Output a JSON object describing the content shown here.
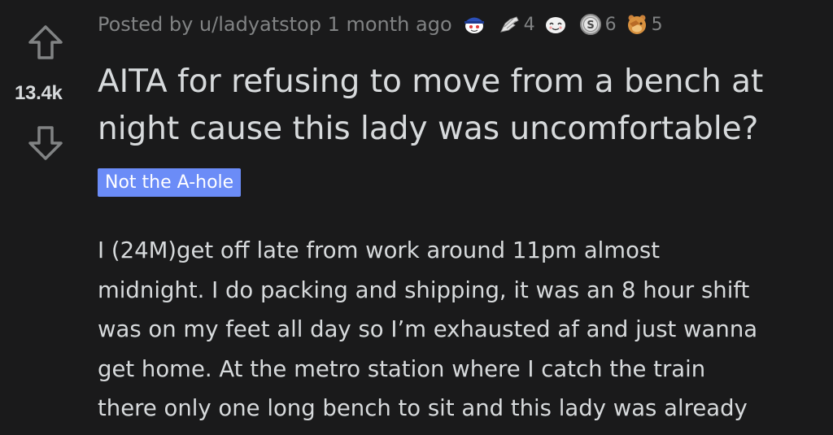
{
  "post": {
    "vote_count": "13.4k",
    "posted_by": "Posted by u/ladyatstop 1 month ago",
    "awards": [
      {
        "icon": "snoo-cap-award-icon",
        "count": ""
      },
      {
        "icon": "helping-hand-award-icon",
        "count": "4"
      },
      {
        "icon": "wholesome-award-icon",
        "count": ""
      },
      {
        "icon": "silver-award-icon",
        "count": "6"
      },
      {
        "icon": "facepalm-award-icon",
        "count": "5"
      }
    ],
    "title": "AITA for refusing to move from a bench at night cause this lady was uncomfortable?",
    "flair": "Not the A-hole",
    "body_lines": [
      "I (24M)get off late from work around 11pm almost",
      "midnight. I do packing and shipping, it was an 8 hour shift",
      "was on my feet all day so I’m exhausted af and just wanna",
      "get home. At the metro station where I catch the train",
      "there only one long bench to sit and this lady was already"
    ]
  },
  "colors": {
    "background": "#1a1a1b",
    "text": "#d7dadc",
    "meta": "#818384",
    "flair_bg": "#6b8cf7",
    "flair_text": "#ffffff"
  }
}
